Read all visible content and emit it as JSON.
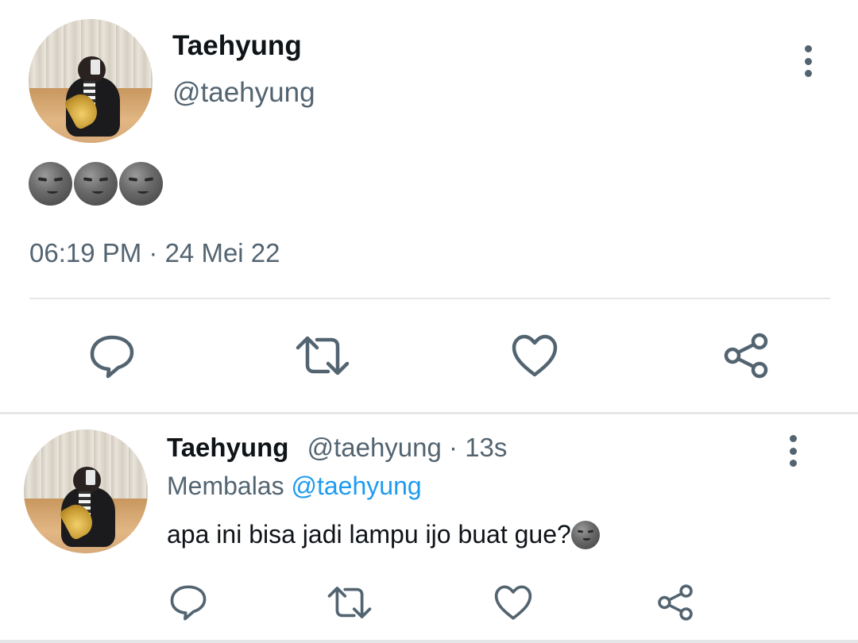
{
  "main_tweet": {
    "display_name": "Taehyung",
    "handle": "@taehyung",
    "emoji_text": "🌚🌚🌚",
    "timestamp": "06:19 PM · 24 Mei 22"
  },
  "reply_tweet": {
    "display_name": "Taehyung",
    "handle": "@taehyung",
    "separator": " · ",
    "time_ago": "13s",
    "replying_to_label": "Membalas",
    "replying_to_handle": "@taehyung",
    "text": "apa ini bisa jadi lampu ijo buat gue?",
    "emoji": "🌚"
  },
  "actions": [
    "reply-icon",
    "retweet-icon",
    "like-icon",
    "share-icon"
  ],
  "icons": [
    "more-vertical-icon",
    "new-moon-face-icon"
  ],
  "colors": {
    "text_primary": "#0f1419",
    "text_secondary": "#536471",
    "link": "#1d9bf0",
    "divider": "#e4e6e8"
  }
}
